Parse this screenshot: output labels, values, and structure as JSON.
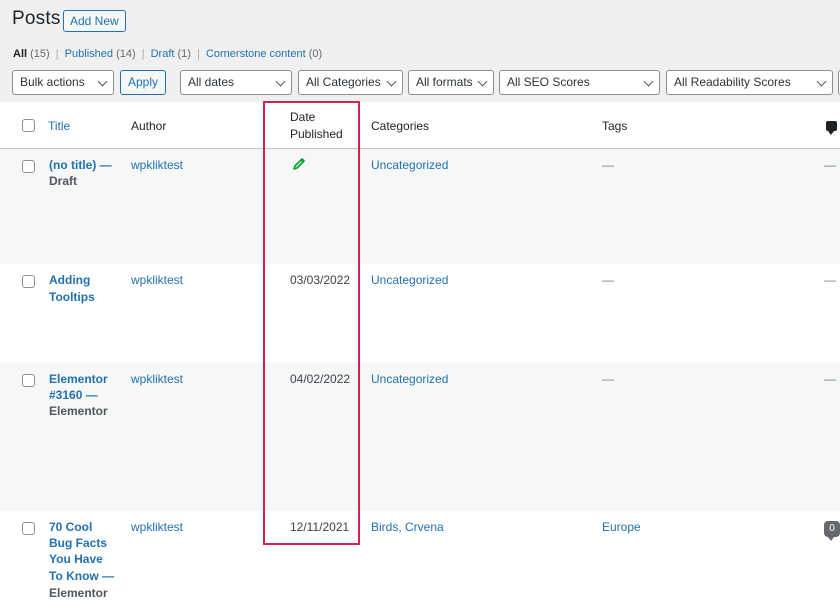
{
  "page": {
    "title": "Posts",
    "add_new": "Add New"
  },
  "filters": {
    "all": "All",
    "all_count": "(15)",
    "published": "Published",
    "published_count": "(14)",
    "draft": "Draft",
    "draft_count": "(1)",
    "cornerstone": "Cornerstone content",
    "cornerstone_count": "(0)",
    "separator": "|"
  },
  "toolbar": {
    "bulk_actions": "Bulk actions",
    "apply": "Apply",
    "dates": "All dates",
    "categories": "All Categories",
    "formats": "All formats",
    "seo": "All SEO Scores",
    "readability": "All Readability Scores"
  },
  "columns": {
    "title": "Title",
    "author": "Author",
    "date_line1": "Date",
    "date_line2": "Published",
    "categories": "Categories",
    "tags": "Tags"
  },
  "rows": [
    {
      "title_lines": [
        "(no title) —"
      ],
      "state": "Draft",
      "author": "wpkliktest",
      "date": "",
      "date_icon": "pencil-icon",
      "categories": "Uncategorized",
      "tags": "—",
      "comments": "—"
    },
    {
      "title_lines": [
        "Adding",
        "Tooltips"
      ],
      "state": "",
      "author": "wpkliktest",
      "date": "03/03/2022",
      "categories": "Uncategorized",
      "tags": "—",
      "comments": "—"
    },
    {
      "title_lines": [
        "Elementor",
        "#3160 —"
      ],
      "state": "Elementor",
      "author": "wpkliktest",
      "date": "04/02/2022",
      "categories": "Uncategorized",
      "tags": "—",
      "comments": "—"
    },
    {
      "title_lines": [
        "70 Cool",
        "Bug Facts",
        "You Have",
        "To Know —"
      ],
      "state": "Elementor",
      "author": "wpkliktest",
      "date": "12/11/2021",
      "categories": "Birds, Crvena",
      "tags": "Europe",
      "comments": "0"
    }
  ],
  "colors": {
    "link": "#2271b1",
    "highlight": "#d7204d",
    "pencil": "#00a32a"
  }
}
